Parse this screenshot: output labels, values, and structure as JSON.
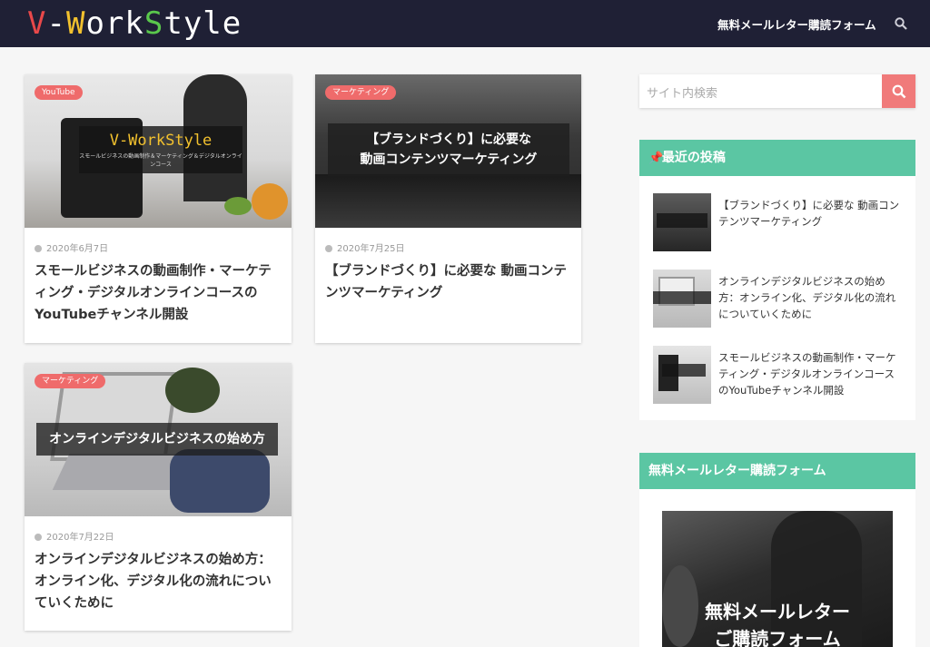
{
  "header": {
    "logo": {
      "v": "V",
      "dash": "-",
      "w": "W",
      "ork": "ork",
      "s": "S",
      "tyle": "tyle"
    },
    "nav_link": "無料メールレター購読フォーム"
  },
  "posts": [
    {
      "category": "YouTube",
      "date": "2020年6月7日",
      "title": "スモールビジネスの動画制作・マーケティング・デジタルオンラインコースのYouTubeチャンネル開設",
      "thumb_logo": "V-WorkStyle",
      "thumb_caption": "スモールビジネスの動画制作＆マーケティング＆デジタルオンラインコース"
    },
    {
      "category": "マーケティング",
      "date": "2020年7月25日",
      "title": "【ブランドづくり】に必要な 動画コンテンツマーケティング",
      "overlay_line1": "【ブランドづくり】に必要な",
      "overlay_line2": "動画コンテンツマーケティング"
    },
    {
      "category": "マーケティング",
      "date": "2020年7月22日",
      "title": "オンラインデジタルビジネスの始め方：オンライン化、デジタル化の流れについていくために",
      "overlay": "オンラインデジタルビジネスの始め方"
    }
  ],
  "sidebar": {
    "search_placeholder": "サイト内検索",
    "recent_heading": "最近の投稿",
    "recent": [
      {
        "title": "【ブランドづくり】に必要な 動画コンテンツマーケティング"
      },
      {
        "title": "オンラインデジタルビジネスの始め方：オンライン化、デジタル化の流れについていくために"
      },
      {
        "title": "スモールビジネスの動画制作・マーケティング・デジタルオンラインコースのYouTubeチャンネル開設"
      }
    ],
    "newsletter_heading": "無料メールレター購読フォーム",
    "newsletter_image_text": "無料メールレター",
    "newsletter_image_text2": "ご購読フォーム"
  },
  "colors": {
    "header_bg": "#1f2035",
    "accent_green": "#5bc6a3",
    "accent_red": "#ef6b6b"
  }
}
